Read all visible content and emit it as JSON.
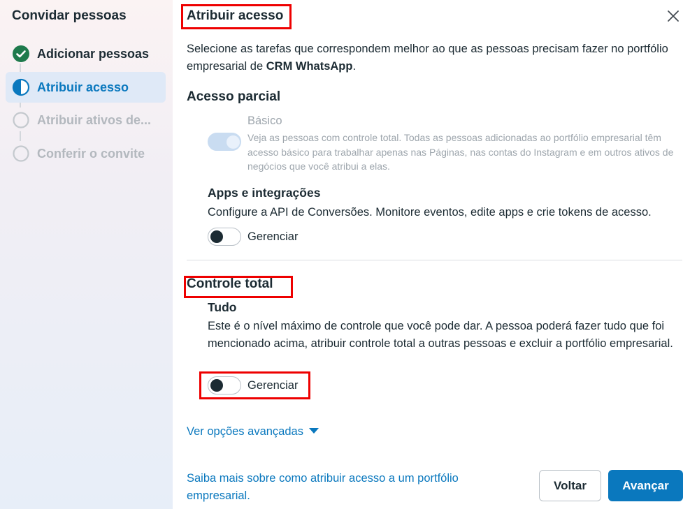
{
  "sidebar": {
    "title": "Convidar pessoas",
    "steps": [
      {
        "label": "Adicionar pessoas",
        "state": "done"
      },
      {
        "label": "Atribuir acesso",
        "state": "active"
      },
      {
        "label": "Atribuir ativos de...",
        "state": "pending"
      },
      {
        "label": "Conferir o convite",
        "state": "pending"
      }
    ]
  },
  "main": {
    "title": "Atribuir acesso",
    "description_prefix": "Selecione as tarefas que correspondem melhor ao que as pessoas precisam fazer no portfólio empresarial de ",
    "portfolio_name": "CRM WhatsApp",
    "description_suffix": ".",
    "partial_access": {
      "title": "Acesso parcial",
      "basic": {
        "title": "Básico",
        "text": "Veja as pessoas com controle total. Todas as pessoas adicionadas ao portfólio empresarial têm acesso básico para trabalhar apenas nas Páginas, nas contas do Instagram e em outros ativos de negócios que você atribui a elas.",
        "toggle_on": true
      },
      "apps": {
        "title": "Apps e integrações",
        "text": "Configure a API de Conversões. Monitore eventos, edite apps e crie tokens de acesso.",
        "toggle_label": "Gerenciar",
        "toggle_on": false
      }
    },
    "full_control": {
      "title": "Controle total",
      "everything": {
        "title": "Tudo",
        "text": "Este é o nível máximo de controle que você pode dar. A pessoa poderá fazer tudo que foi mencionado acima, atribuir controle total a outras pessoas e excluir a portfólio empresarial.",
        "toggle_label": "Gerenciar",
        "toggle_on": false
      }
    },
    "advanced_link": "Ver opções avançadas",
    "learn_more_link": "Saiba mais sobre como atribuir acesso a um portfólio empresarial.",
    "back_button": "Voltar",
    "next_button": "Avançar"
  },
  "colors": {
    "accent": "#0a78be",
    "done_green": "#1e7a4c",
    "highlight_red": "#ee0000"
  }
}
